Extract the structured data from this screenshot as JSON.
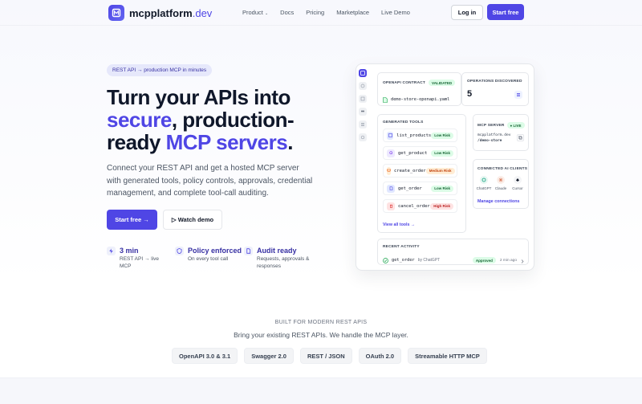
{
  "brand": {
    "name": "mcpplatform",
    "tld": ".dev",
    "primary_color": "#4f46e5"
  },
  "nav": {
    "items": [
      "Product",
      "Docs",
      "Pricing",
      "Marketplace",
      "Live Demo"
    ],
    "product_caret": "⌄",
    "login": "Log in",
    "start_free": "Start free"
  },
  "hero": {
    "pill": "REST API → production MCP in minutes",
    "headline_1": "Turn your APIs into",
    "headline_accent_1": "secure",
    "headline_2": ", production-",
    "headline_3": "ready ",
    "headline_accent_2": "MCP servers",
    "headline_4": ".",
    "subtitle": "Connect your REST API and get a hosted MCP server with generated tools, policy controls, approvals, credential management, and complete tool-call auditing.",
    "cta_primary": "Start free →",
    "cta_secondary": "▷ Watch demo",
    "features": [
      {
        "title": "3 min",
        "desc": "REST API → live MCP",
        "icon": "bolt-icon"
      },
      {
        "title": "Policy enforced",
        "desc": "On every tool call",
        "icon": "shield-icon"
      },
      {
        "title": "Audit ready",
        "desc": "Requests, approvals & responses",
        "icon": "document-icon"
      }
    ]
  },
  "dashboard": {
    "contract": {
      "label": "OPENAPI CONTRACT",
      "status": "VALIDATED",
      "file": "demo-store-openapi.yaml"
    },
    "operations": {
      "label": "OPERATIONS DISCOVERED",
      "count": "5"
    },
    "tools": {
      "label": "GENERATED TOOLS",
      "items": [
        {
          "name": "list_products",
          "risk": "Low Risk",
          "level": "low",
          "icon_color": "#e0e7ff"
        },
        {
          "name": "get_product",
          "risk": "Low Risk",
          "level": "low",
          "icon_color": "#ede9fe"
        },
        {
          "name": "create_order",
          "risk": "Medium Risk",
          "level": "medium",
          "icon_color": "#ffedd5"
        },
        {
          "name": "get_order",
          "risk": "Low Risk",
          "level": "low",
          "icon_color": "#e0e7ff"
        },
        {
          "name": "cancel_order",
          "risk": "High Risk",
          "level": "high",
          "icon_color": "#fee2e2"
        }
      ],
      "view_all": "View all tools →"
    },
    "server": {
      "label": "MCP SERVER",
      "status": "● LIVE",
      "url_1": "mcpplatform.dev",
      "url_2": "/demo-store"
    },
    "clients": {
      "label": "CONNECTED AI CLIENTS",
      "items": [
        {
          "name": "ChatGPT",
          "color": "#10a37f"
        },
        {
          "name": "Claude",
          "color": "#d97757"
        },
        {
          "name": "Cursor",
          "color": "#111827"
        }
      ],
      "manage": "Manage connections"
    },
    "activity": {
      "label": "RECENT ACTIVITY",
      "tool": "get_order",
      "by": "by ChatGPT",
      "status": "Approved",
      "time": "2 min ago"
    }
  },
  "footer": {
    "built_for": "BUILT FOR MODERN REST APIS",
    "tagline": "Bring your existing REST APIs. We handle the MCP layer.",
    "chips": [
      "OpenAPI 3.0 & 3.1",
      "Swagger 2.0",
      "REST / JSON",
      "OAuth 2.0",
      "Streamable HTTP MCP"
    ]
  }
}
